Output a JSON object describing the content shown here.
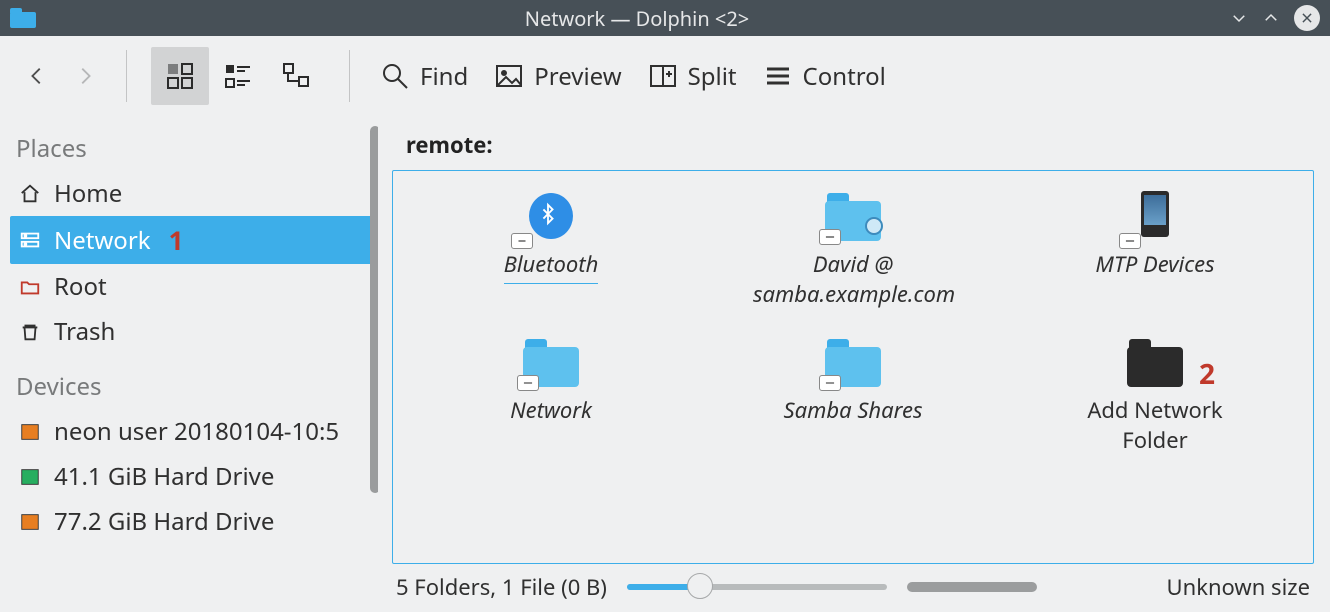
{
  "window": {
    "title": "Network — Dolphin <2>"
  },
  "toolbar": {
    "find": "Find",
    "preview": "Preview",
    "split": "Split",
    "control": "Control"
  },
  "sidebar": {
    "places_header": "Places",
    "devices_header": "Devices",
    "places": [
      {
        "label": "Home",
        "icon": "home"
      },
      {
        "label": "Network",
        "icon": "network",
        "selected": true,
        "annotation": "1"
      },
      {
        "label": "Root",
        "icon": "root"
      },
      {
        "label": "Trash",
        "icon": "trash"
      }
    ],
    "devices": [
      {
        "label": "neon user 20180104-10:5",
        "icon": "disk-orange"
      },
      {
        "label": "41.1 GiB Hard Drive",
        "icon": "disk-green"
      },
      {
        "label": "77.2 GiB Hard Drive",
        "icon": "disk-orange"
      }
    ]
  },
  "main": {
    "location": "remote:",
    "items": [
      {
        "label": "Bluetooth",
        "icon": "bluetooth",
        "selected": true
      },
      {
        "label": "David @ samba.example.com",
        "icon": "net-folder-globe"
      },
      {
        "label": "MTP Devices",
        "icon": "mtp"
      },
      {
        "label": "Network",
        "icon": "net-folder"
      },
      {
        "label": "Samba Shares",
        "icon": "net-folder"
      },
      {
        "label": "Add Network Folder",
        "icon": "add-folder",
        "regular": true,
        "annotation": "2"
      }
    ]
  },
  "status": {
    "summary": "5 Folders, 1 File (0 B)",
    "size_label": "Unknown size"
  }
}
